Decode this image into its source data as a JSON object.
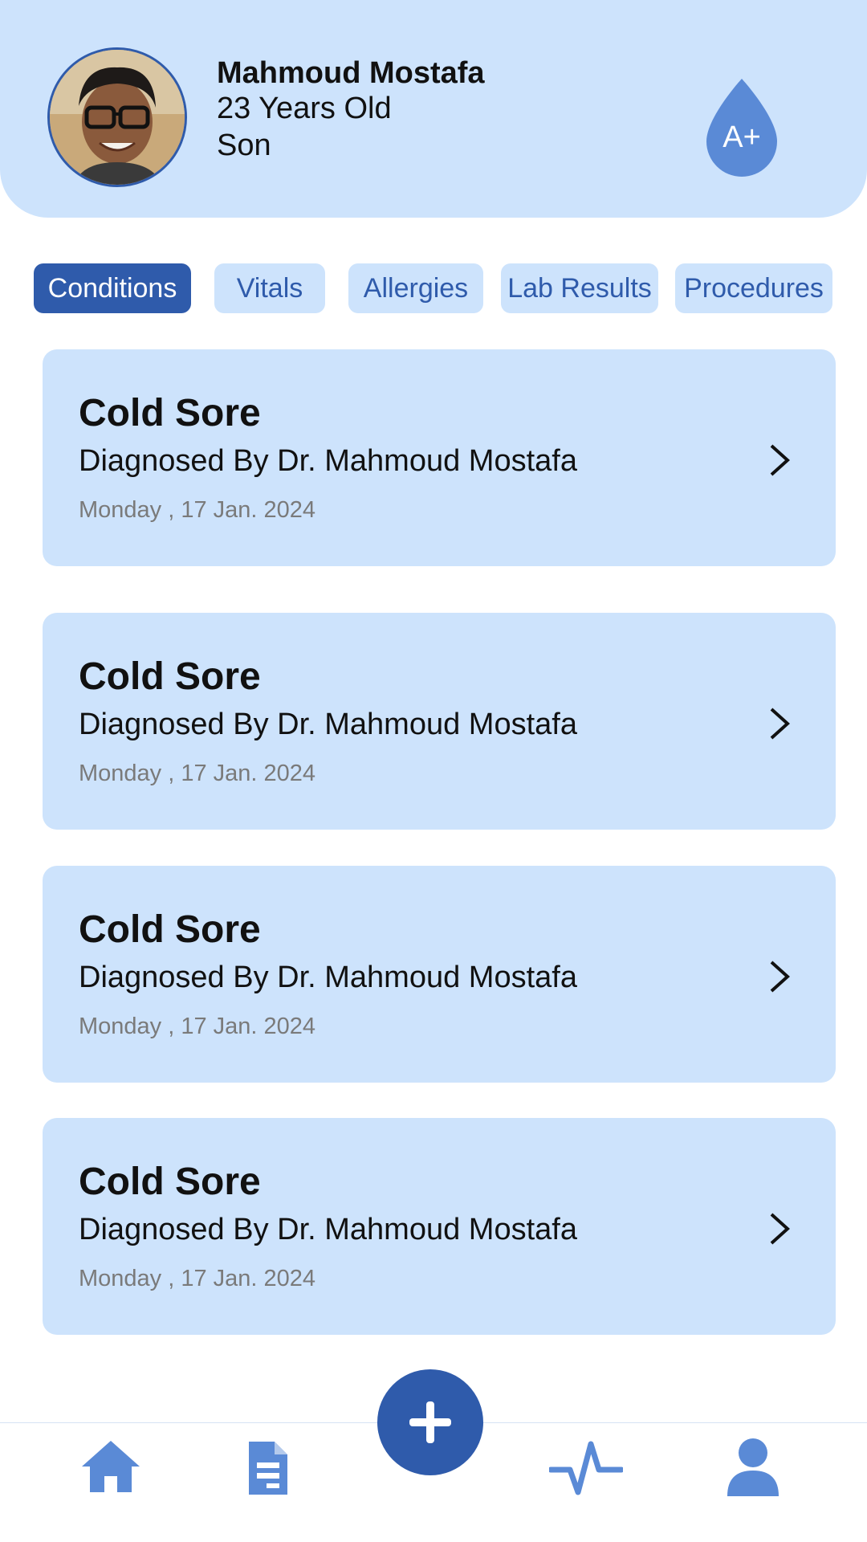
{
  "profile": {
    "name": "Mahmoud Mostafa",
    "age": "23 Years Old",
    "relation": "Son",
    "blood_type": "A+"
  },
  "tabs": [
    {
      "label": "Conditions",
      "active": true
    },
    {
      "label": "Vitals",
      "active": false
    },
    {
      "label": "Allergies",
      "active": false
    },
    {
      "label": "Lab Results",
      "active": false
    },
    {
      "label": "Procedures",
      "active": false
    }
  ],
  "conditions": [
    {
      "title": "Cold Sore",
      "doctor": "Diagnosed By Dr. Mahmoud Mostafa",
      "date": "Monday , 17 Jan. 2024"
    },
    {
      "title": "Cold Sore",
      "doctor": "Diagnosed By Dr. Mahmoud Mostafa",
      "date": "Monday , 17 Jan. 2024"
    },
    {
      "title": "Cold Sore",
      "doctor": "Diagnosed By Dr. Mahmoud Mostafa",
      "date": "Monday , 17 Jan. 2024"
    },
    {
      "title": "Cold Sore",
      "doctor": "Diagnosed By Dr. Mahmoud Mostafa",
      "date": "Monday , 17 Jan. 2024"
    }
  ],
  "nav": {
    "items": [
      "home-icon",
      "document-icon",
      "add-icon",
      "heartbeat-icon",
      "profile-icon"
    ]
  },
  "colors": {
    "primary": "#2f5bab",
    "light": "#cde3fc",
    "icon": "#5a8ad6",
    "muted": "#7a7a7a"
  }
}
